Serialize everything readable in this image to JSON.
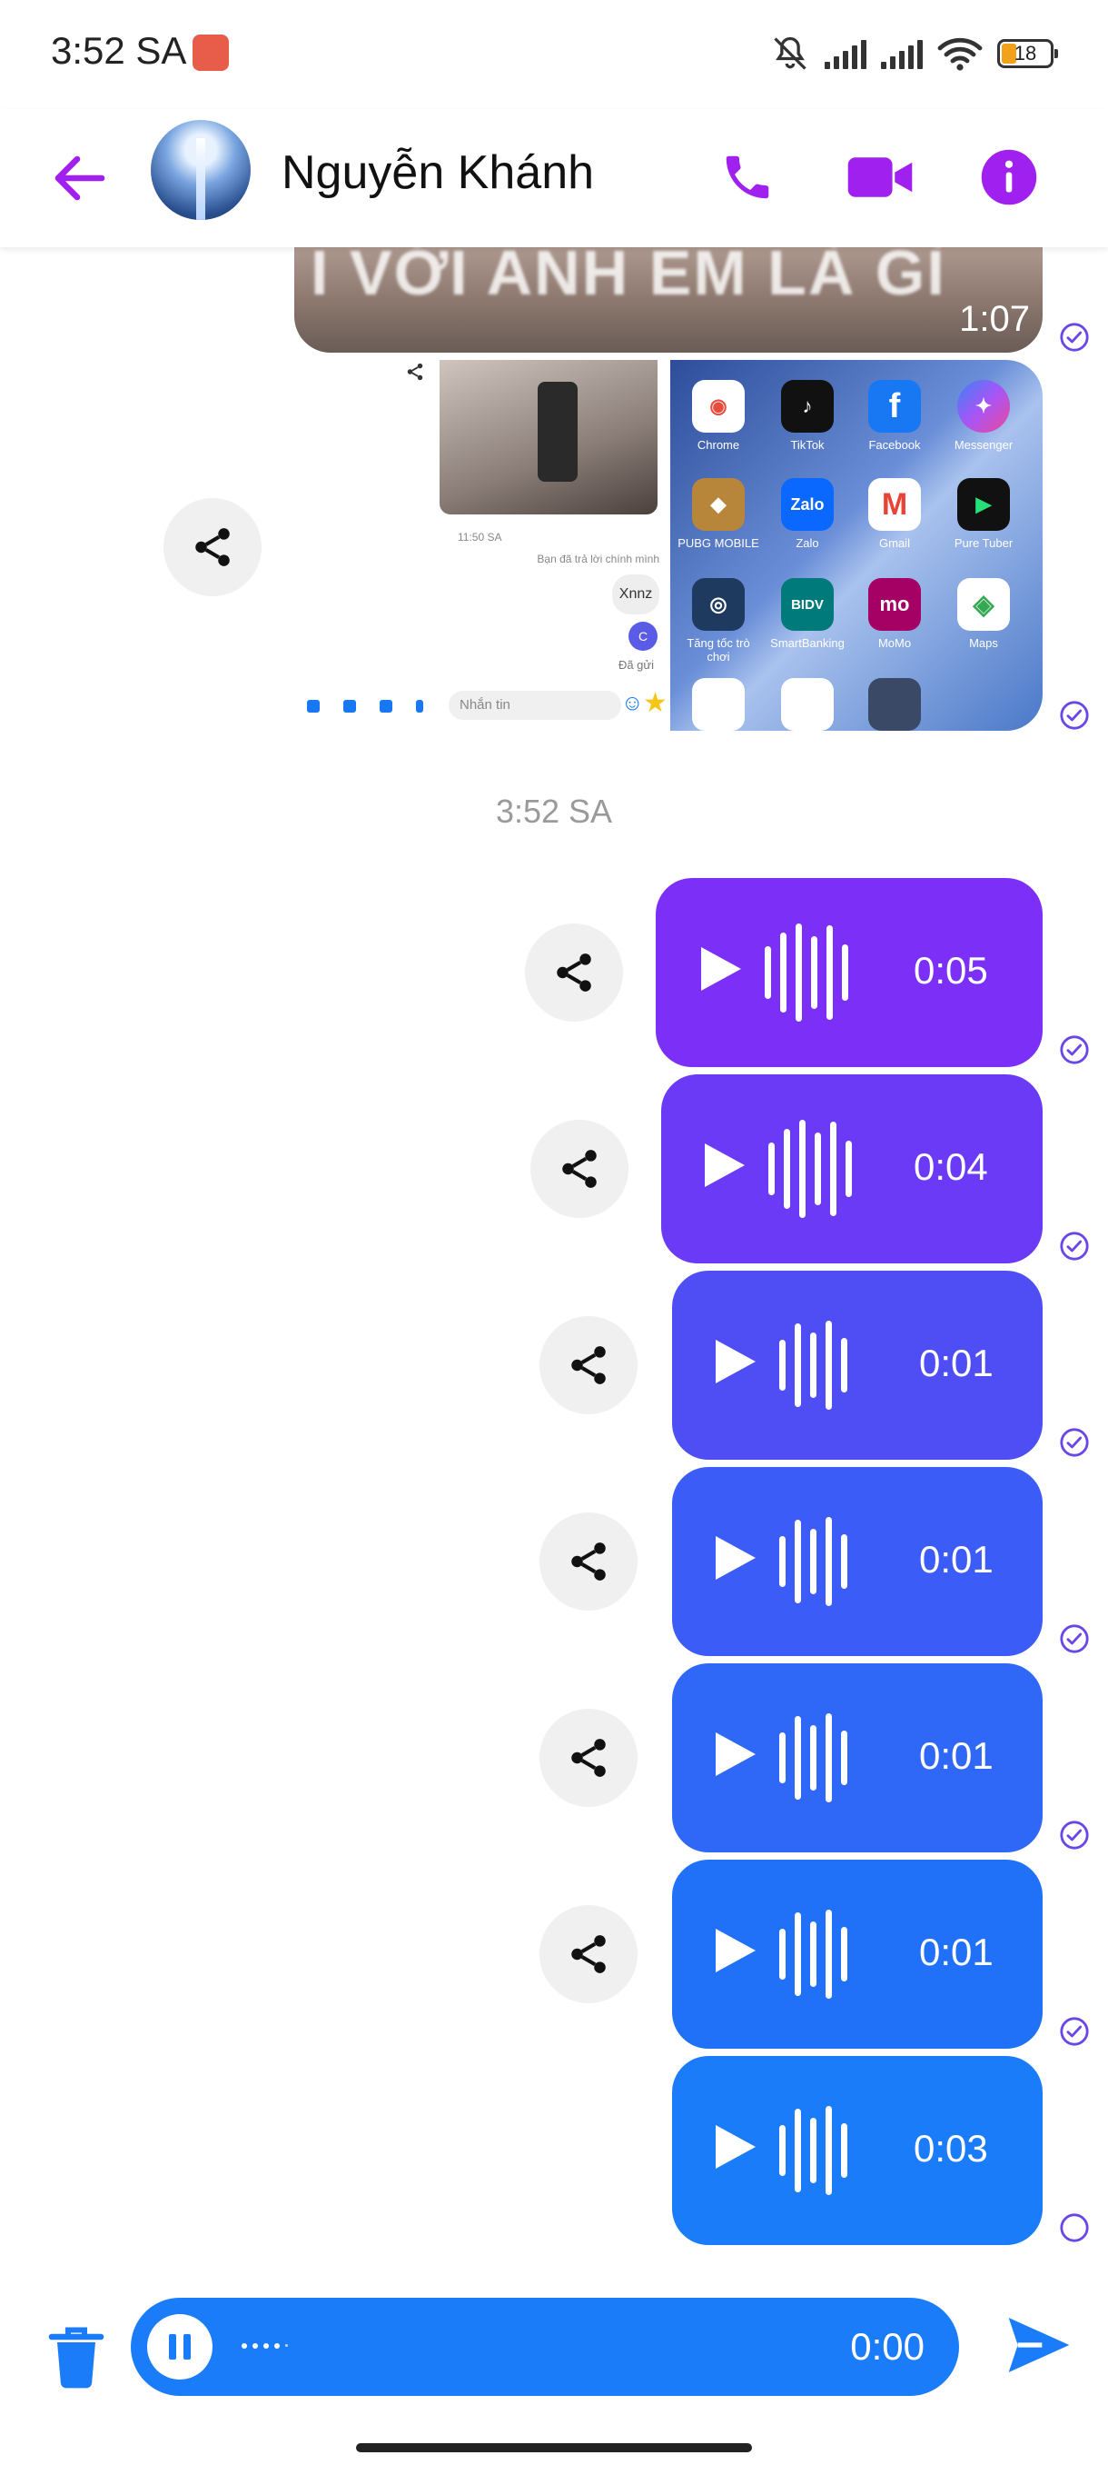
{
  "status_bar": {
    "time": "3:52 SA",
    "battery": "18"
  },
  "header": {
    "contact_name": "Nguyễn Khánh"
  },
  "video_message": {
    "caption_text": "I VỚI ANH EM LÀ GÌ",
    "duration": "1:07"
  },
  "screenshot_left": {
    "time_label": "11:50 SA",
    "reply_note": "Bạn đã trả lời chính mình",
    "bubble_text": "Xnnz",
    "avatar_letter": "C",
    "sent_label": "Đã gửi",
    "input_placeholder": "Nhắn tin"
  },
  "screenshot_right": {
    "apps": [
      {
        "label": "Chrome",
        "color": "#ffffff",
        "glyph": "◉"
      },
      {
        "label": "TikTok",
        "color": "#111111",
        "glyph": "♪"
      },
      {
        "label": "Facebook",
        "color": "#1877f2",
        "glyph": "f"
      },
      {
        "label": "Messenger",
        "color": "#8b5cf6",
        "glyph": "✦"
      },
      {
        "label": "PUBG MOBILE",
        "color": "#b8863b",
        "glyph": "◆"
      },
      {
        "label": "Zalo",
        "color": "#0a68ff",
        "glyph": "Zalo"
      },
      {
        "label": "Gmail",
        "color": "#ffffff",
        "glyph": "M"
      },
      {
        "label": "Pure Tuber",
        "color": "#111111",
        "glyph": "▶"
      },
      {
        "label": "Tăng tốc trò chơi",
        "color": "#1e3a5f",
        "glyph": "◎"
      },
      {
        "label": "SmartBanking",
        "color": "#007a7a",
        "glyph": "BIDV"
      },
      {
        "label": "MoMo",
        "color": "#a50064",
        "glyph": "mo"
      },
      {
        "label": "Maps",
        "color": "#ffffff",
        "glyph": "◈"
      }
    ]
  },
  "timestamp": "3:52 SA",
  "voice_messages": [
    {
      "duration": "0:05",
      "color": "#7b2ff7"
    },
    {
      "duration": "0:04",
      "color": "#6a3af6"
    },
    {
      "duration": "0:01",
      "color": "#4f4ef5"
    },
    {
      "duration": "0:01",
      "color": "#3b5cf6"
    },
    {
      "duration": "0:01",
      "color": "#2f68f7"
    },
    {
      "duration": "0:01",
      "color": "#2070f8"
    },
    {
      "duration": "0:03",
      "color": "#1b7cf9"
    }
  ],
  "composer": {
    "recording_time": "0:00"
  },
  "colors": {
    "accent": "#a020f0",
    "send": "#1b7cf9",
    "check": "#6b46e6"
  }
}
